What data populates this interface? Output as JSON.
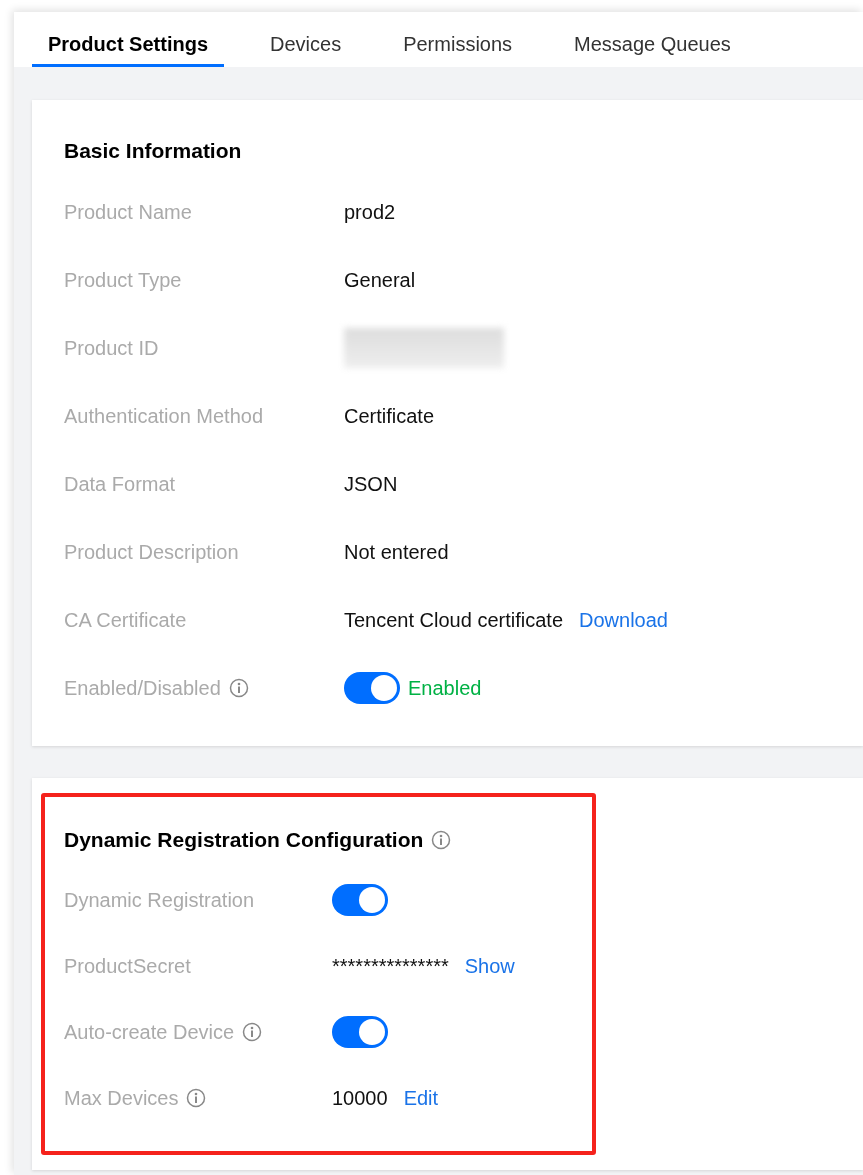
{
  "tabs": [
    {
      "label": "Product Settings",
      "selected": true
    },
    {
      "label": "Devices",
      "selected": false
    },
    {
      "label": "Permissions",
      "selected": false
    },
    {
      "label": "Message Queues",
      "selected": false
    }
  ],
  "sections": [
    {
      "title": "Basic Information",
      "info": false,
      "highlighted": false,
      "rows": [
        {
          "kind": "text",
          "label": "Product Name",
          "info": false,
          "value": "prod2"
        },
        {
          "kind": "text",
          "label": "Product Type",
          "info": false,
          "value": "General"
        },
        {
          "kind": "redacted",
          "label": "Product ID",
          "info": false
        },
        {
          "kind": "text",
          "label": "Authentication Method",
          "info": false,
          "value": "Certificate"
        },
        {
          "kind": "text",
          "label": "Data Format",
          "info": false,
          "value": "JSON"
        },
        {
          "kind": "text",
          "label": "Product Description",
          "info": false,
          "value": "Not entered"
        },
        {
          "kind": "text_link",
          "label": "CA Certificate",
          "info": false,
          "value": "Tencent Cloud certificate",
          "link": "Download"
        },
        {
          "kind": "switch",
          "label": "Enabled/Disabled",
          "info": true,
          "on": true,
          "status": "Enabled"
        }
      ]
    },
    {
      "title": "Dynamic Registration Configuration",
      "info": true,
      "highlighted": true,
      "rows": [
        {
          "kind": "switch",
          "label": "Dynamic Registration",
          "info": false,
          "on": true
        },
        {
          "kind": "text_link",
          "label": "ProductSecret",
          "info": false,
          "value": "***************",
          "link": "Show"
        },
        {
          "kind": "switch",
          "label": "Auto-create Device",
          "info": true,
          "on": true
        },
        {
          "kind": "text_link",
          "label": "Max Devices",
          "info": true,
          "value": "10000",
          "link": "Edit"
        }
      ]
    }
  ]
}
